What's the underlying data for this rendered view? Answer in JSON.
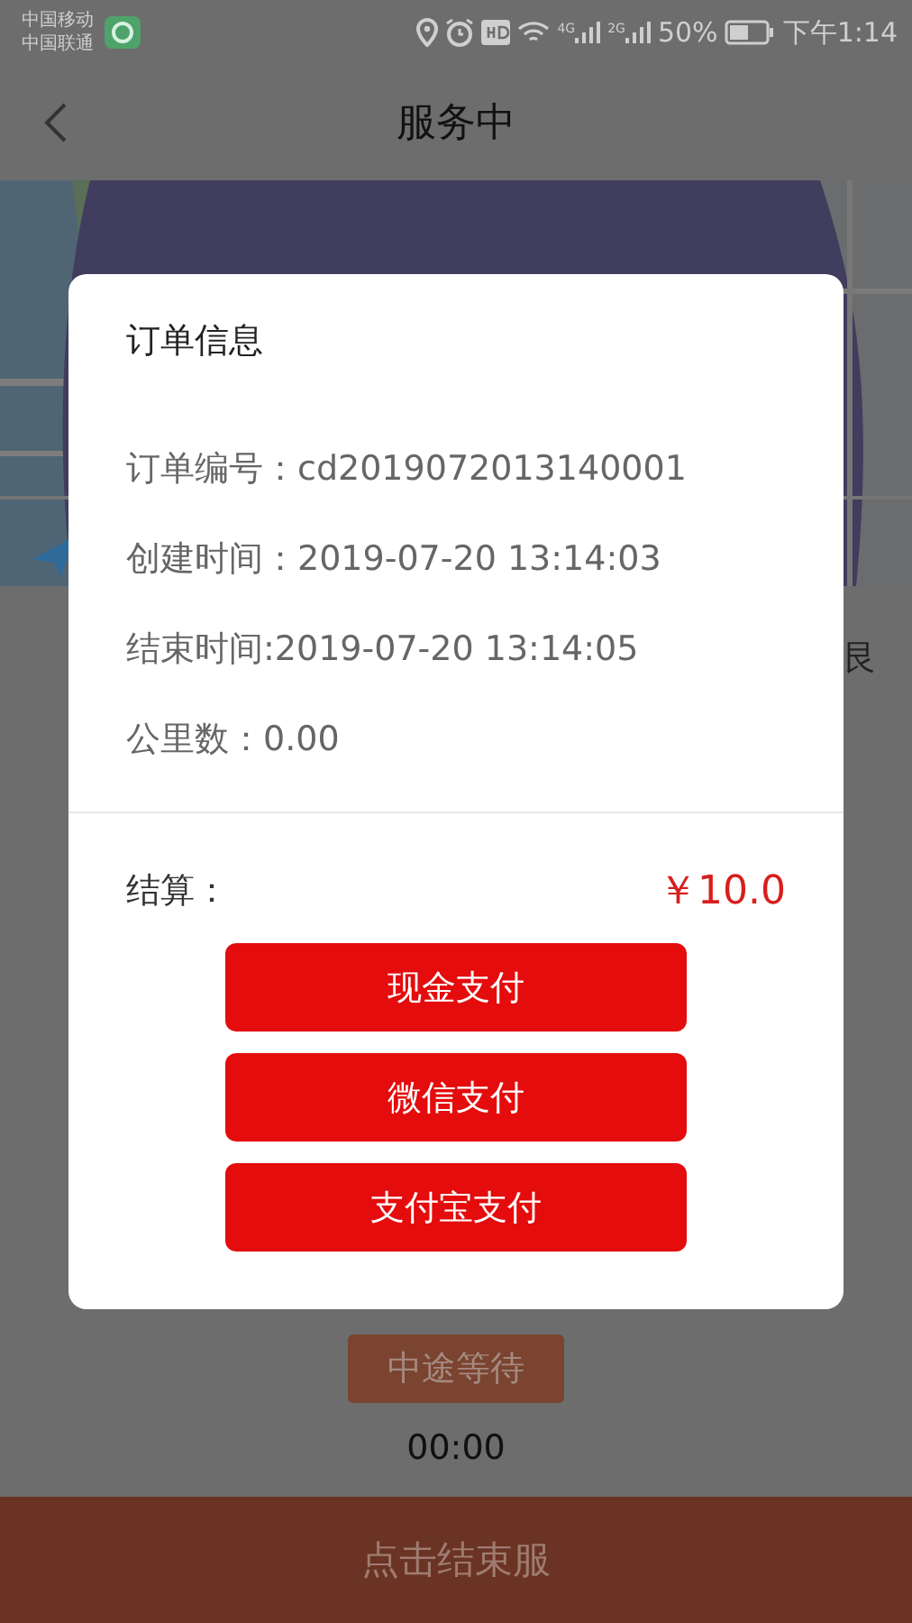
{
  "status_bar": {
    "carriers": [
      "中国移动",
      "中国联通"
    ],
    "networks": [
      "4G",
      "2G"
    ],
    "battery": "50%",
    "time": "下午1:14"
  },
  "header": {
    "title": "服务中"
  },
  "background": {
    "side_text": "艮",
    "wait_button": "中途等待",
    "timer": "00:00",
    "end_button": "点击结束服"
  },
  "dialog": {
    "title": "订单信息",
    "fields": [
      "订单编号：cd2019072013140001",
      "创建时间：2019-07-20 13:14:03",
      "结束时间:2019-07-20 13:14:05",
      "公里数：0.00"
    ],
    "total_label": "结算：",
    "total": "￥10.0",
    "payments": [
      "现金支付",
      "微信支付",
      "支付宝支付"
    ]
  }
}
